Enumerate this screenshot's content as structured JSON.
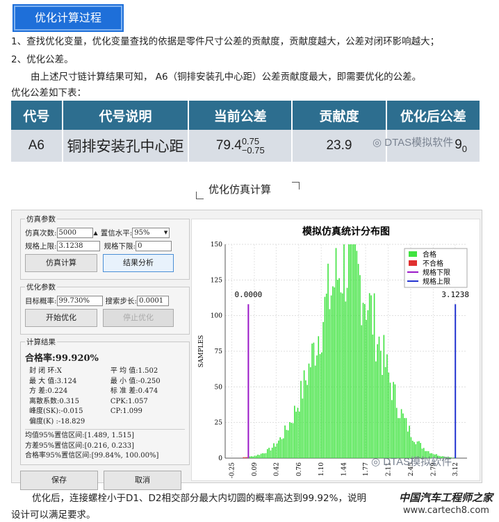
{
  "header": {
    "title": "优化计算过程"
  },
  "body": {
    "line1": "1、查找优化变量，优化变量查找的依据是零件尺寸公差的贡献度，贡献度越大，公差对闭环影响越大；",
    "line2": "2、优化公差。",
    "line3": "由上述尺寸链计算结果可知， A6（铜排安装孔中心距）公差贡献度最大，即需要优化的公差。",
    "line4": "优化公差如下表：",
    "bottom1": "优化后，连接螺栓小于D1、D2相交部分最大内切圆的概率高达到99.92%，说明",
    "bottom2": "设计可以满足要求。"
  },
  "table": {
    "headers": [
      "代号",
      "代号说明",
      "当前公差",
      "贡献度",
      "优化后公差"
    ],
    "row": {
      "code": "A6",
      "desc": "铜排安装孔中心距",
      "nominal": "79.4",
      "upper": "0.75",
      "lower": "−0.75",
      "contribution": "23.9",
      "optimized_partial": "9",
      "optimized_sub": "0"
    }
  },
  "sim_title": "优化仿真计算",
  "watermarks": {
    "wm1": "DTAS模拟软件",
    "wm2": "DTAS模拟软件",
    "site_name": "中国汽车工程师之家",
    "site_url": "www.cartech8.com"
  },
  "app": {
    "sim_params": {
      "group": "仿真参数",
      "count_label": "仿真次数:",
      "count_value": "5000",
      "conf_label": "置信水平:",
      "conf_value": "95%",
      "upper_label": "规格上限:",
      "upper_value": "3.1238",
      "lower_label": "规格下限:",
      "lower_value": "0",
      "btn_simulate": "仿真计算",
      "btn_analyze": "结果分析"
    },
    "opt_params": {
      "group": "优化参数",
      "target_label": "目标概率:",
      "target_value": "99.730%",
      "step_label": "搜索步长:",
      "step_value": "0.0001",
      "btn_start": "开始优化",
      "btn_stop": "停止优化"
    },
    "results": {
      "group": "计算结果",
      "pass_rate": "合格率:99.920%",
      "stats": [
        [
          "封 闭 环:X",
          "平 均 值:1.502"
        ],
        [
          "最 大 值:3.124",
          "最 小 值:-0.250"
        ],
        [
          "方    差:0.224",
          "标 准 差:0.474"
        ],
        [
          "离散系数:0.315",
          "CPK:1.057"
        ],
        [
          "峰度(SK):-0.015",
          "CP:1.099"
        ],
        [
          "偏度(K) :-18.829",
          ""
        ]
      ],
      "ci": [
        "均值95%置信区间:[1.489, 1.515]",
        "方差95%置信区间:[0.216, 0.233]",
        "合格率95%置信区间:[99.84%, 100.00%]"
      ]
    },
    "btn_save": "保存",
    "btn_cancel": "取消"
  },
  "chart_data": {
    "type": "bar",
    "title": "模拟仿真统计分布图",
    "ylabel": "SAMPLES",
    "ylim": [
      0,
      150
    ],
    "yticks": [
      "0",
      "25",
      "50",
      "75",
      "100",
      "125",
      "150"
    ],
    "xticks": [
      "-0.25",
      "0.09",
      "0.42",
      "0.76",
      "1.10",
      "1.44",
      "1.77",
      "2.11",
      "2.45",
      "2.79",
      "3.12"
    ],
    "xlim": [
      -0.35,
      3.3
    ],
    "legend": [
      "合格",
      "不合格",
      "规格下限",
      "规格上限"
    ],
    "legend_position": "top-right",
    "colors": {
      "pass": "#3fe33f",
      "fail": "#e03030",
      "lower": "#9a19c8",
      "upper": "#2233d0"
    },
    "limits": {
      "lower": 0.0,
      "upper": 3.1238,
      "lower_label": "0.0000",
      "upper_label": "3.1238"
    },
    "distribution": {
      "mean": 1.502,
      "std": 0.474,
      "peak": 150,
      "bins": 140
    }
  }
}
